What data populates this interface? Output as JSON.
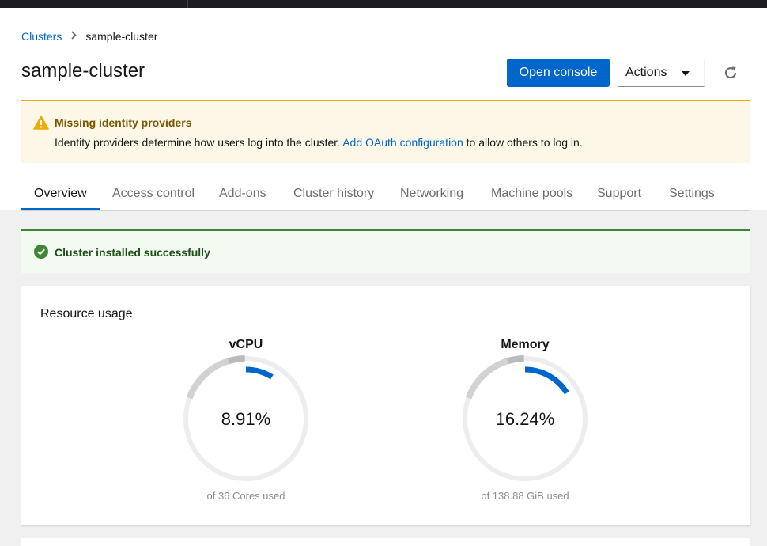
{
  "breadcrumb": {
    "root": "Clusters",
    "current": "sample-cluster"
  },
  "page": {
    "title": "sample-cluster"
  },
  "toolbar": {
    "open_console": "Open console",
    "actions": "Actions"
  },
  "warning": {
    "title": "Missing identity providers",
    "body_before": "Identity providers determine how users log into the cluster.",
    "link": "Add OAuth configuration",
    "body_after": "to allow others to log in."
  },
  "tabs": [
    {
      "label": "Overview",
      "active": true
    },
    {
      "label": "Access control"
    },
    {
      "label": "Add-ons"
    },
    {
      "label": "Cluster history"
    },
    {
      "label": "Networking"
    },
    {
      "label": "Machine pools"
    },
    {
      "label": "Support"
    },
    {
      "label": "Settings"
    }
  ],
  "success": {
    "title": "Cluster installed successfully"
  },
  "resource_usage": {
    "title": "Resource usage",
    "gauges": [
      {
        "name": "vCPU",
        "value": "8.91%",
        "percent": 8.91,
        "subtitle": "of 36 Cores used"
      },
      {
        "name": "Memory",
        "value": "16.24%",
        "percent": 16.24,
        "subtitle": "of 138.88 GiB used"
      }
    ]
  },
  "colors": {
    "primary": "#0066cc",
    "warning": "#f0ab00",
    "success": "#3e8635",
    "gauge_track": "#ededed",
    "gauge_threshold": "#b8bbbe"
  },
  "icons": {
    "breadcrumb_separator": "chevron-right-icon",
    "refresh": "redo-icon",
    "warning": "exclamation-triangle-icon",
    "success": "check-circle-icon",
    "dropdown": "caret-down-icon"
  }
}
